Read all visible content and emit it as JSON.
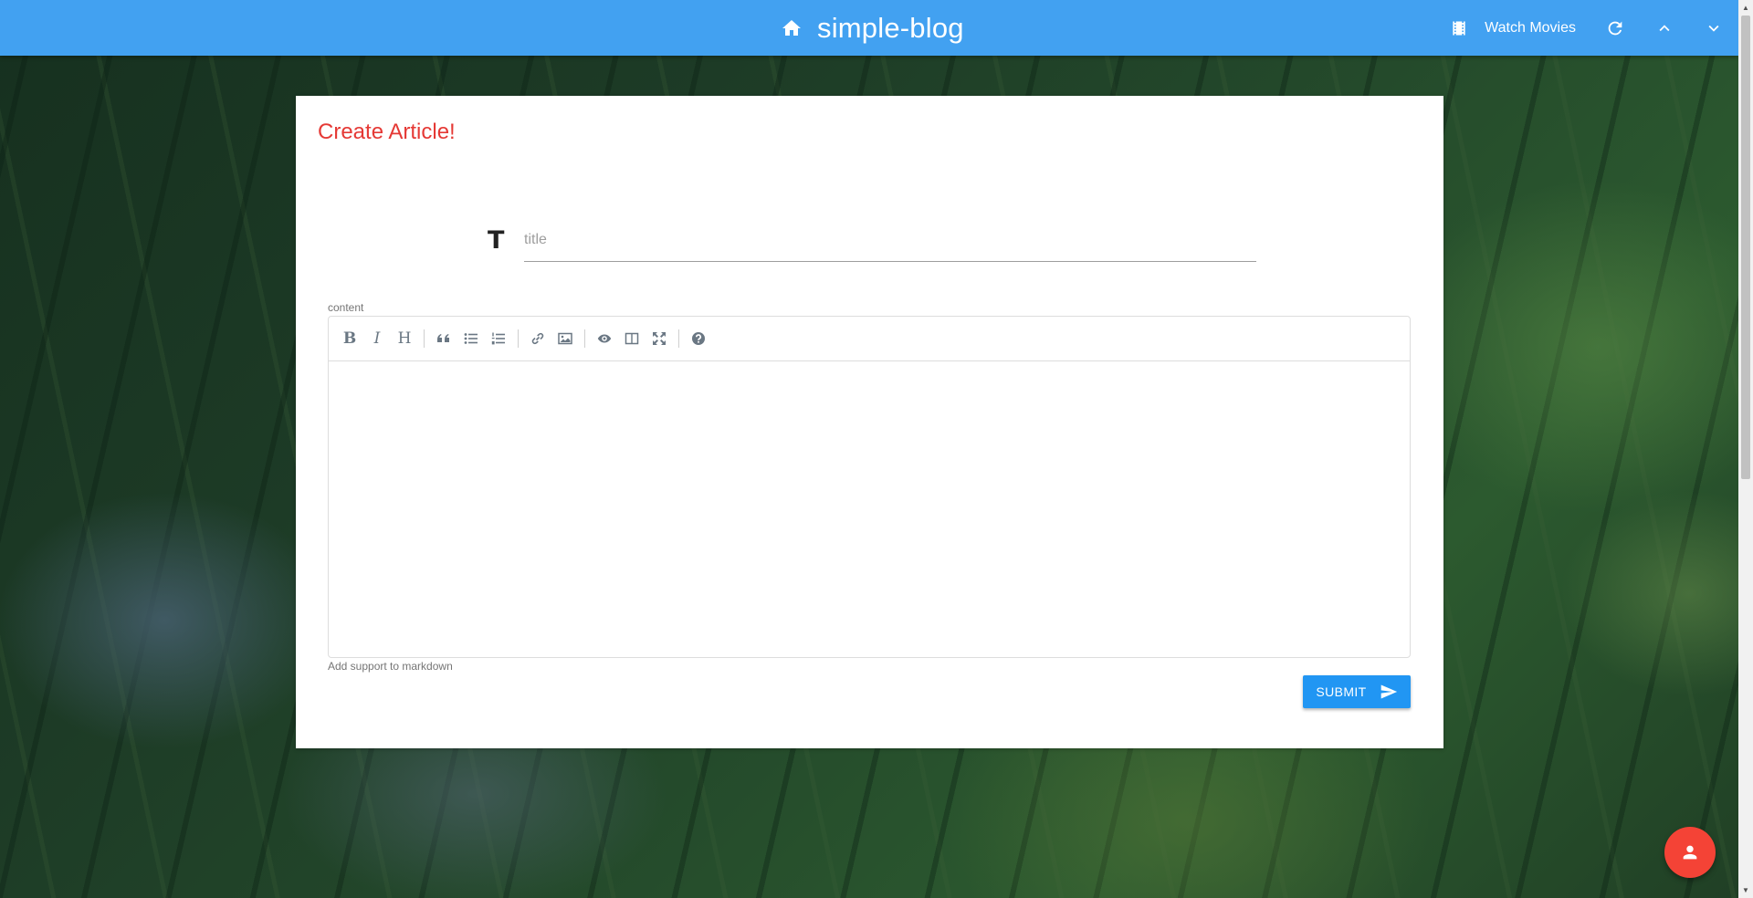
{
  "header": {
    "title": "simple-blog",
    "watch_movies_label": "Watch Movies",
    "bar_color": "#42a1f1"
  },
  "form": {
    "heading": "Create Article!",
    "title_placeholder": "title",
    "title_value": "",
    "content_label": "content",
    "editor_content": "",
    "hint": "Add support to markdown",
    "submit_label": "SUBMIT",
    "toolbar": [
      "bold",
      "italic",
      "heading",
      "quote",
      "unordered-list",
      "ordered-list",
      "link",
      "image",
      "preview",
      "side-by-side",
      "fullscreen",
      "guide"
    ]
  },
  "colors": {
    "heading": "#e53935",
    "submit": "#2196f3",
    "fab": "#f44336"
  }
}
